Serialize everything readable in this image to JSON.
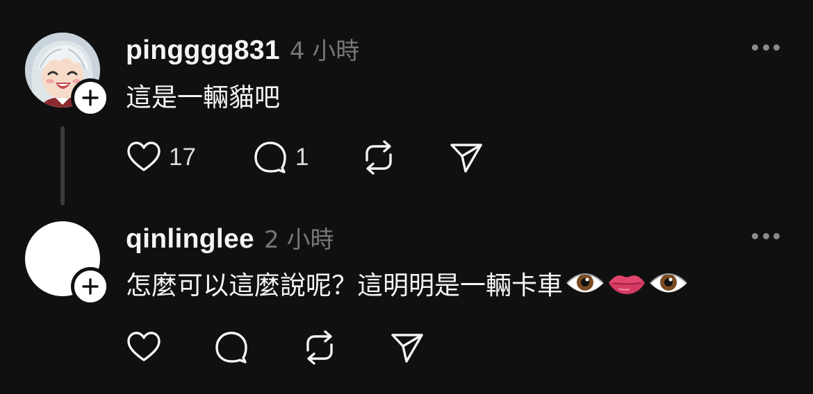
{
  "posts": [
    {
      "username": "pingggg831",
      "time": "4 小時",
      "text": "這是一輛貓吧",
      "likes": "17",
      "replies": "1",
      "avatar": "anime-girl-avatar"
    },
    {
      "username": "qinlinglee",
      "time": "2 小時",
      "text": "怎麼可以這麼說呢？這明明是一輛卡車",
      "emojis": [
        "eye-emoji",
        "lips-emoji",
        "eye-emoji"
      ],
      "avatar": "blank-white-avatar"
    }
  ],
  "icons": {
    "like": "heart-icon",
    "reply": "comment-icon",
    "repost": "repost-icon",
    "share": "send-icon",
    "more": "more-icon",
    "follow": "plus-icon"
  },
  "colors": {
    "background": "#101010",
    "text": "#f3f5f7",
    "muted": "#777777"
  }
}
